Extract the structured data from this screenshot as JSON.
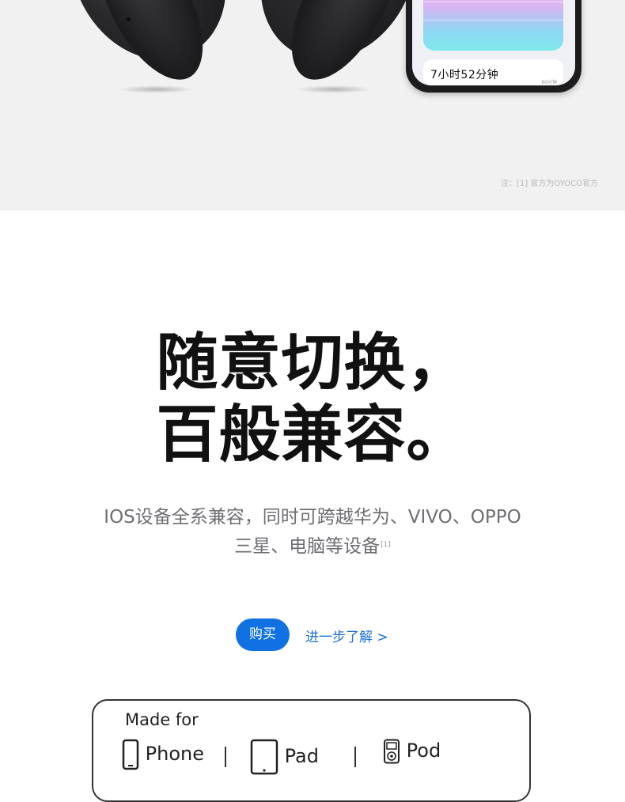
{
  "hero": {
    "phone_time": "7小时52分钟",
    "phone_caption": "60分钟",
    "footnote": "注：[1] 官方为OYOCO官方"
  },
  "headline": {
    "line1": "随意切换，",
    "line2": "百般兼容。"
  },
  "description": {
    "line1": "IOS设备全系兼容，同时可跨越华为、VIVO、OPPO",
    "line2": "三星、电脑等设备",
    "ref_mark": "[1]"
  },
  "actions": {
    "buy_label": "购买",
    "learn_more_label": "进一步了解 >"
  },
  "mfi_badge": {
    "title": "Made for",
    "items": [
      "Phone",
      "Pad",
      "Pod"
    ]
  },
  "colors": {
    "accent": "#1071e2",
    "link": "#1a6fd6",
    "hero_bg": "#f1f1f2"
  }
}
